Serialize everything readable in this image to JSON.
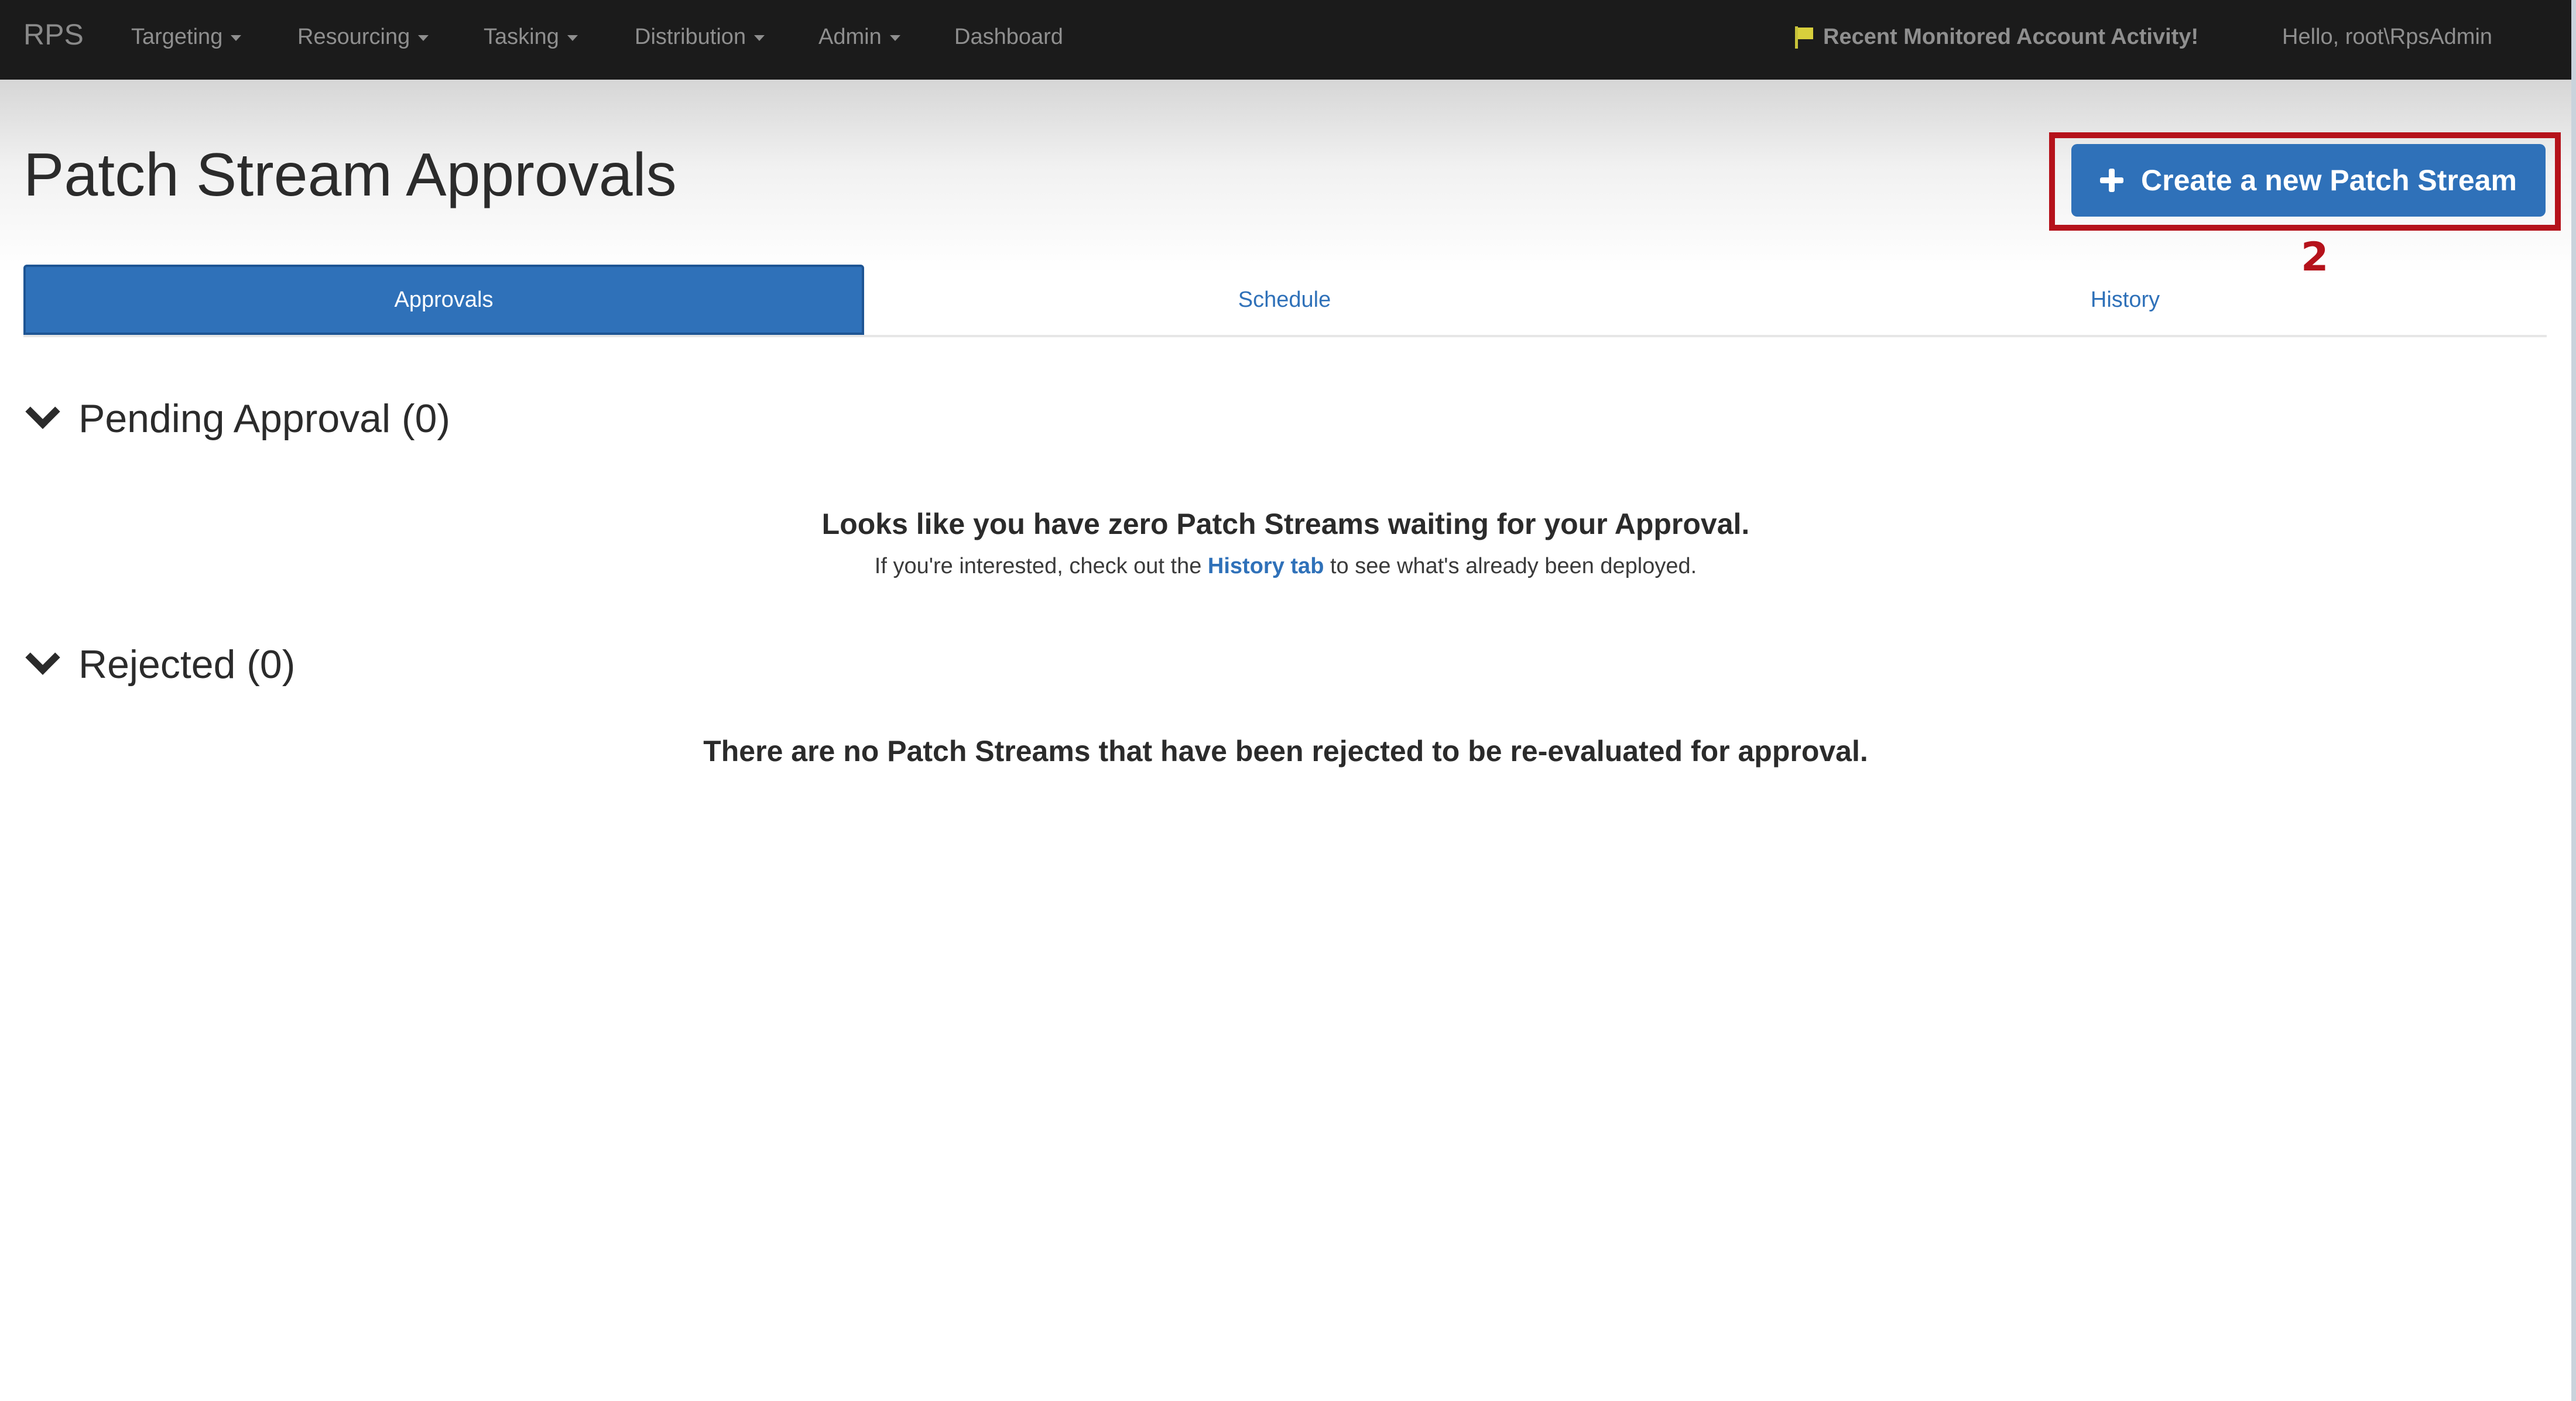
{
  "navbar": {
    "brand": "RPS",
    "menu": [
      {
        "label": "Targeting",
        "dropdown": true
      },
      {
        "label": "Resourcing",
        "dropdown": true
      },
      {
        "label": "Tasking",
        "dropdown": true
      },
      {
        "label": "Distribution",
        "dropdown": true
      },
      {
        "label": "Admin",
        "dropdown": true
      },
      {
        "label": "Dashboard",
        "dropdown": false
      }
    ],
    "alert": "Recent Monitored Account Activity!",
    "greeting": "Hello, root\\RpsAdmin"
  },
  "page": {
    "title": "Patch Stream Approvals",
    "create_button": "Create a new Patch Stream",
    "annotation_step": "2"
  },
  "tabs": [
    {
      "label": "Approvals",
      "active": true
    },
    {
      "label": "Schedule",
      "active": false
    },
    {
      "label": "History",
      "active": false
    }
  ],
  "pending": {
    "heading": "Pending Approval (0)",
    "empty_message": "Looks like you have zero Patch Streams waiting for your Approval.",
    "hint_prefix": "If you're interested, check out the",
    "hint_link": "History tab",
    "hint_suffix": "to see what's already been deployed."
  },
  "rejected": {
    "heading": "Rejected (0)",
    "empty_message": "There are no Patch Streams that have been rejected to be re-evaluated for approval."
  },
  "colors": {
    "navbar_bg": "#1b1b1b",
    "primary": "#2f71b9",
    "annotation": "#b5121b",
    "flag": "#d8d03c"
  }
}
